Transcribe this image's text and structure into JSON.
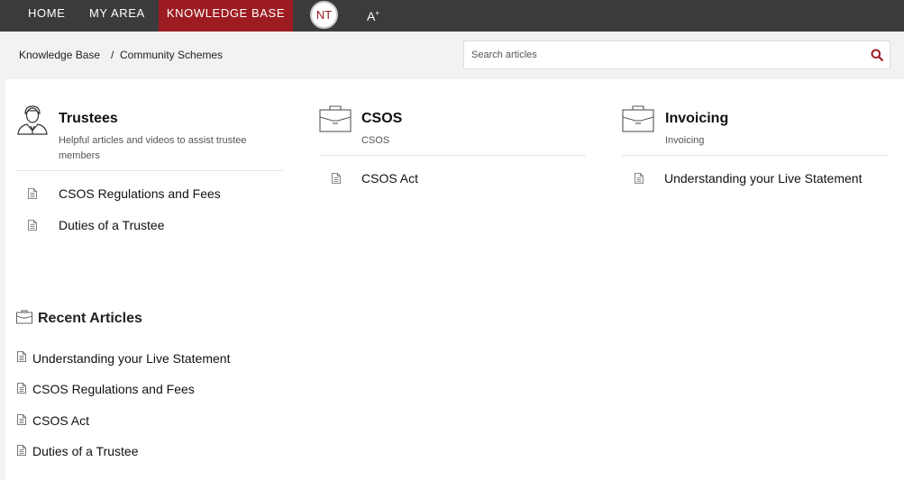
{
  "nav": {
    "home": "HOME",
    "my_area": "MY AREA",
    "knowledge_base": "KNOWLEDGE BASE",
    "avatar_initials": "NT",
    "font_size_label": "A"
  },
  "breadcrumb": {
    "root": "Knowledge Base",
    "separator": "/",
    "current": "Community Schemes"
  },
  "search": {
    "placeholder": "Search articles",
    "value": ""
  },
  "colors": {
    "nav_bg": "#3b3b3b",
    "accent": "#9c1c22"
  },
  "categories": [
    {
      "icon": "trustee-person-icon",
      "title": "Trustees",
      "description": "Helpful articles and videos to assist trustee members",
      "articles": [
        "CSOS Regulations and Fees",
        "Duties of a Trustee"
      ]
    },
    {
      "icon": "briefcase-icon",
      "title": "CSOS",
      "description": "CSOS",
      "articles": [
        "CSOS Act"
      ]
    },
    {
      "icon": "briefcase-icon",
      "title": "Invoicing",
      "description": "Invoicing",
      "articles": [
        "Understanding your Live Statement"
      ]
    }
  ],
  "recent": {
    "title": "Recent Articles",
    "icon": "briefcase-icon",
    "articles": [
      "Understanding your Live Statement",
      "CSOS Regulations and Fees",
      "CSOS Act",
      "Duties of a Trustee"
    ]
  }
}
